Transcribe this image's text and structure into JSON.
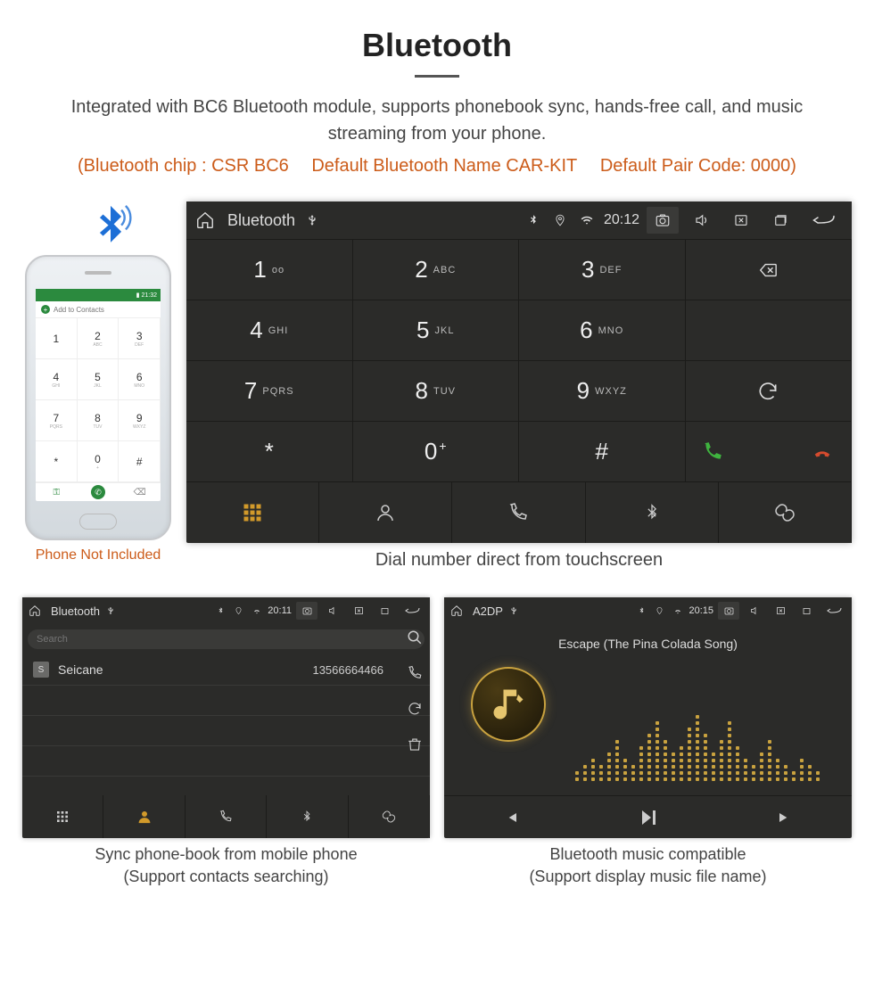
{
  "header": {
    "title": "Bluetooth",
    "description": "Integrated with BC6 Bluetooth module, supports phonebook sync, hands-free call, and music streaming from your phone.",
    "spec_chip": "(Bluetooth chip : CSR BC6",
    "spec_name": "Default Bluetooth Name CAR-KIT",
    "spec_code": "Default Pair Code: 0000)"
  },
  "phone": {
    "not_included": "Phone Not Included",
    "add_contacts": "Add to Contacts",
    "keys": [
      {
        "n": "1",
        "s": ""
      },
      {
        "n": "2",
        "s": "ABC"
      },
      {
        "n": "3",
        "s": "DEF"
      },
      {
        "n": "4",
        "s": "GHI"
      },
      {
        "n": "5",
        "s": "JKL"
      },
      {
        "n": "6",
        "s": "MNO"
      },
      {
        "n": "7",
        "s": "PQRS"
      },
      {
        "n": "8",
        "s": "TUV"
      },
      {
        "n": "9",
        "s": "WXYZ"
      },
      {
        "n": "*",
        "s": ""
      },
      {
        "n": "0",
        "s": "+"
      },
      {
        "n": "#",
        "s": ""
      }
    ]
  },
  "main": {
    "caption": "Dial number direct from touchscreen",
    "status": {
      "title": "Bluetooth",
      "time": "20:12"
    },
    "keypad": [
      {
        "n": "1",
        "s": "oo"
      },
      {
        "n": "2",
        "s": "ABC"
      },
      {
        "n": "3",
        "s": "DEF"
      },
      {
        "n": "4",
        "s": "GHI"
      },
      {
        "n": "5",
        "s": "JKL"
      },
      {
        "n": "6",
        "s": "MNO"
      },
      {
        "n": "7",
        "s": "PQRS"
      },
      {
        "n": "8",
        "s": "TUV"
      },
      {
        "n": "9",
        "s": "WXYZ"
      },
      {
        "n": "*",
        "s": ""
      },
      {
        "n": "0",
        "s": "+"
      },
      {
        "n": "#",
        "s": ""
      }
    ]
  },
  "phonebook": {
    "caption1": "Sync phone-book from mobile phone",
    "caption2": "(Support contacts searching)",
    "status": {
      "title": "Bluetooth",
      "time": "20:11"
    },
    "search_placeholder": "Search",
    "contact": {
      "initial": "S",
      "name": "Seicane",
      "number": "13566664466"
    }
  },
  "music": {
    "caption1": "Bluetooth music compatible",
    "caption2": "(Support display music file name)",
    "status": {
      "title": "A2DP",
      "time": "20:15"
    },
    "song": "Escape (The Pina Colada Song)",
    "eq_heights": [
      2,
      3,
      4,
      3,
      5,
      7,
      4,
      3,
      6,
      8,
      10,
      7,
      5,
      6,
      9,
      11,
      8,
      5,
      7,
      10,
      6,
      4,
      3,
      5,
      7,
      4,
      3,
      2,
      4,
      3,
      2
    ]
  }
}
